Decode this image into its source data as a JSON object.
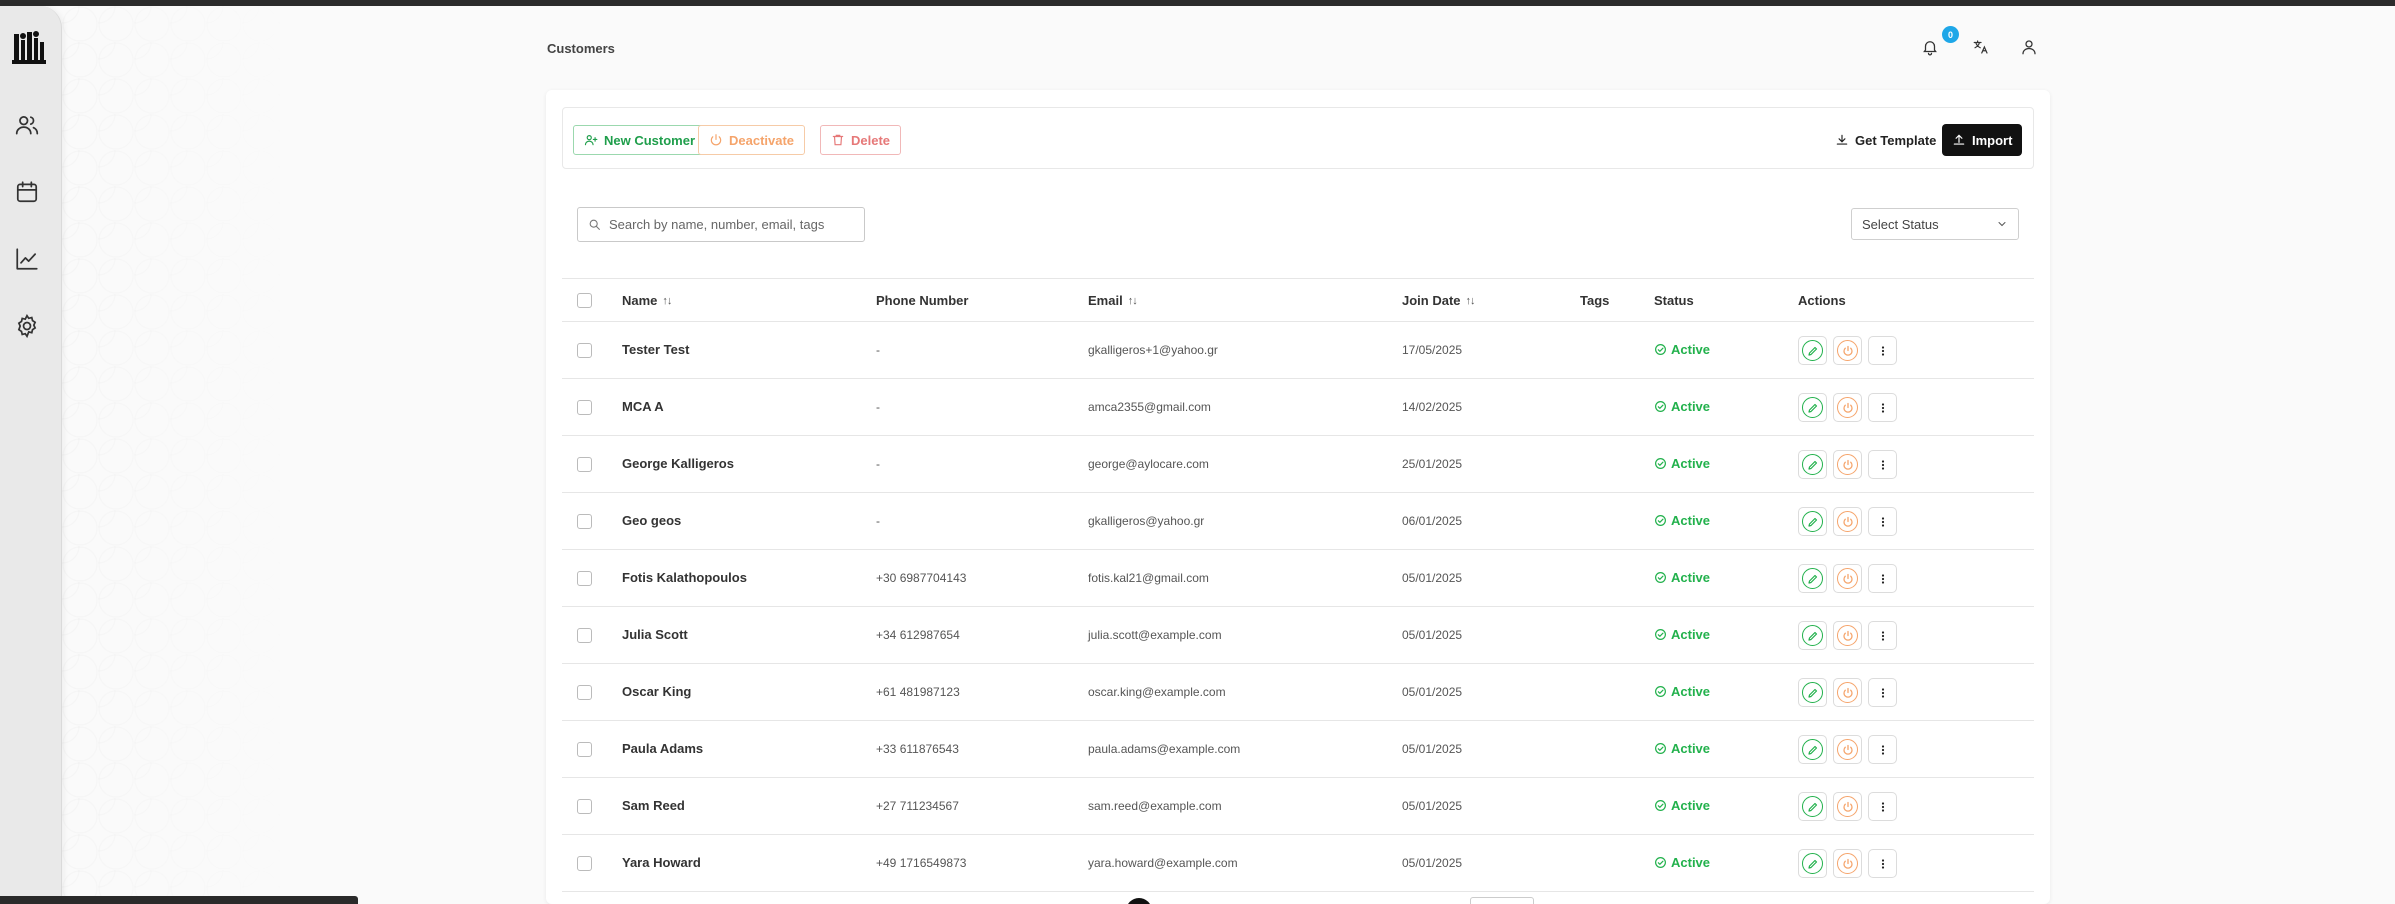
{
  "header": {
    "page_title": "Customers",
    "notification_count": "0"
  },
  "toolbar": {
    "new_customer": "New Customer",
    "deactivate": "Deactivate",
    "delete": "Delete",
    "get_template": "Get Template",
    "import": "Import"
  },
  "search": {
    "placeholder": "Search by name, number, email, tags"
  },
  "status_filter": {
    "selected": "Select Status"
  },
  "table": {
    "columns": {
      "name": "Name",
      "phone": "Phone Number",
      "email": "Email",
      "join_date": "Join Date",
      "tags": "Tags",
      "status": "Status",
      "actions": "Actions"
    },
    "rows": [
      {
        "name": "Tester Test",
        "phone": "-",
        "email": "gkalligeros+1@yahoo.gr",
        "join_date": "17/05/2025",
        "tags": "",
        "status": "Active"
      },
      {
        "name": "MCA A",
        "phone": "-",
        "email": "amca2355@gmail.com",
        "join_date": "14/02/2025",
        "tags": "",
        "status": "Active"
      },
      {
        "name": "George Kalligeros",
        "phone": "-",
        "email": "george@aylocare.com",
        "join_date": "25/01/2025",
        "tags": "",
        "status": "Active"
      },
      {
        "name": "Geo geos",
        "phone": "-",
        "email": "gkalligeros@yahoo.gr",
        "join_date": "06/01/2025",
        "tags": "",
        "status": "Active"
      },
      {
        "name": "Fotis Kalathopoulos",
        "phone": "+30 6987704143",
        "email": "fotis.kal21@gmail.com",
        "join_date": "05/01/2025",
        "tags": "",
        "status": "Active"
      },
      {
        "name": "Julia Scott",
        "phone": "+34 612987654",
        "email": "julia.scott@example.com",
        "join_date": "05/01/2025",
        "tags": "",
        "status": "Active"
      },
      {
        "name": "Oscar King",
        "phone": "+61 481987123",
        "email": "oscar.king@example.com",
        "join_date": "05/01/2025",
        "tags": "",
        "status": "Active"
      },
      {
        "name": "Paula Adams",
        "phone": "+33 611876543",
        "email": "paula.adams@example.com",
        "join_date": "05/01/2025",
        "tags": "",
        "status": "Active"
      },
      {
        "name": "Sam Reed",
        "phone": "+27 711234567",
        "email": "sam.reed@example.com",
        "join_date": "05/01/2025",
        "tags": "",
        "status": "Active"
      },
      {
        "name": "Yara Howard",
        "phone": "+49 1716549873",
        "email": "yara.howard@example.com",
        "join_date": "05/01/2025",
        "tags": "",
        "status": "Active"
      }
    ]
  },
  "colors": {
    "accent_green": "#22b14c",
    "deactivate_orange": "#f5a46b",
    "delete_red": "#e67878",
    "badge_blue": "#1ea7e8"
  },
  "icons": {
    "sidebar": [
      "users-icon",
      "calendar-icon",
      "chart-icon",
      "gear-icon"
    ],
    "header": [
      "bell-icon",
      "translate-icon",
      "user-icon"
    ]
  }
}
